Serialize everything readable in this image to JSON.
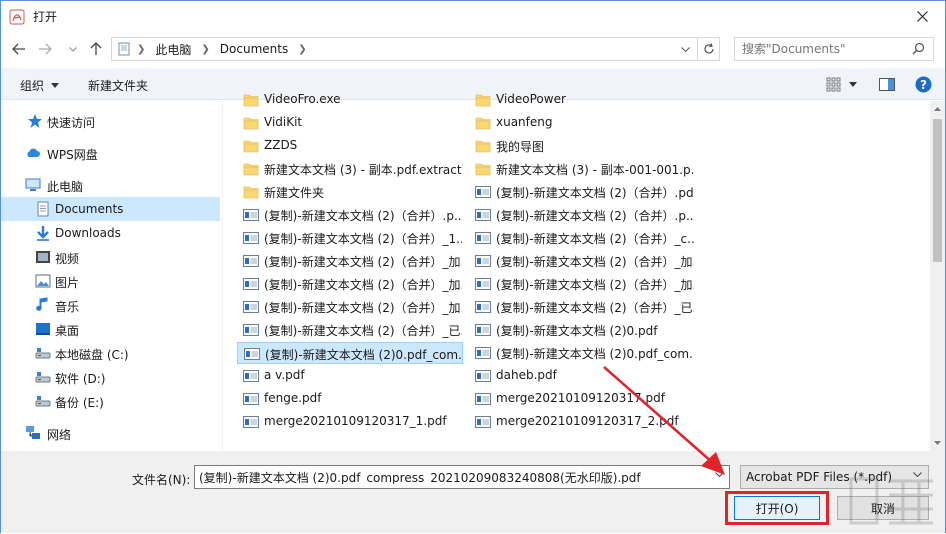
{
  "window": {
    "title": "打开"
  },
  "address": {
    "segments": [
      "此电脑",
      "Documents"
    ]
  },
  "search": {
    "placeholder": "搜索\"Documents\""
  },
  "toolbar": {
    "organize": "组织",
    "new_folder": "新建文件夹"
  },
  "nav": {
    "items": [
      {
        "label": "快速访问",
        "icon": "star-icon"
      },
      {
        "label": "WPS网盘",
        "icon": "cloud-icon"
      },
      {
        "label": "此电脑",
        "icon": "computer-icon"
      },
      {
        "label": "Documents",
        "icon": "document-icon",
        "selected": true
      },
      {
        "label": "Downloads",
        "icon": "download-icon"
      },
      {
        "label": "视频",
        "icon": "video-icon"
      },
      {
        "label": "图片",
        "icon": "picture-icon"
      },
      {
        "label": "音乐",
        "icon": "music-icon"
      },
      {
        "label": "桌面",
        "icon": "desktop-icon"
      },
      {
        "label": "本地磁盘 (C:)",
        "icon": "drive-icon"
      },
      {
        "label": "软件 (D:)",
        "icon": "drive-icon"
      },
      {
        "label": "备份 (E:)",
        "icon": "drive-icon"
      },
      {
        "label": "网络",
        "icon": "network-icon"
      }
    ]
  },
  "files": {
    "left": [
      {
        "name": "VideoFro.exe",
        "type": "folder"
      },
      {
        "name": "VidiKit",
        "type": "folder"
      },
      {
        "name": "ZZDS",
        "type": "folder"
      },
      {
        "name": "新建文本文档 (3) - 副本.pdf.extract...",
        "type": "folder"
      },
      {
        "name": "新建文件夹",
        "type": "folder"
      },
      {
        "name": "(复制)-新建文本文档 (2)（合并）.p...",
        "type": "pdf"
      },
      {
        "name": "(复制)-新建文本文档 (2)（合并）_1....",
        "type": "pdf"
      },
      {
        "name": "(复制)-新建文本文档 (2)（合并）_加...",
        "type": "pdf"
      },
      {
        "name": "(复制)-新建文本文档 (2)（合并）_加...",
        "type": "pdf"
      },
      {
        "name": "(复制)-新建文本文档 (2)（合并）_加...",
        "type": "pdf"
      },
      {
        "name": "(复制)-新建文本文档 (2)（合并）_已...",
        "type": "pdf"
      },
      {
        "name": "(复制)-新建文本文档 (2)0.pdf_com...",
        "type": "pdf",
        "selected": true
      },
      {
        "name": "a v.pdf",
        "type": "pdf"
      },
      {
        "name": "fenge.pdf",
        "type": "pdf"
      },
      {
        "name": "merge20210109120317_1.pdf",
        "type": "pdf"
      }
    ],
    "right": [
      {
        "name": "VideoPower",
        "type": "folder"
      },
      {
        "name": "xuanfeng",
        "type": "folder"
      },
      {
        "name": "我的导图",
        "type": "folder"
      },
      {
        "name": "新建文本文档 (3) - 副本-001-001.p...",
        "type": "folder"
      },
      {
        "name": "(复制)-新建文本文档 (2)（合并）.pdf",
        "type": "pdf"
      },
      {
        "name": "(复制)-新建文本文档 (2)（合并）.p...",
        "type": "pdf"
      },
      {
        "name": "(复制)-新建文本文档 (2)（合并）_c...",
        "type": "pdf"
      },
      {
        "name": "(复制)-新建文本文档 (2)（合并）_加...",
        "type": "pdf"
      },
      {
        "name": "(复制)-新建文本文档 (2)（合并）_加...",
        "type": "pdf"
      },
      {
        "name": "(复制)-新建文本文档 (2)（合并）_已...",
        "type": "pdf"
      },
      {
        "name": "(复制)-新建文本文档 (2)0.pdf",
        "type": "pdf"
      },
      {
        "name": "(复制)-新建文本文档 (2)0.pdf_com...",
        "type": "pdf"
      },
      {
        "name": "daheb.pdf",
        "type": "pdf"
      },
      {
        "name": "merge20210109120317.pdf",
        "type": "pdf"
      },
      {
        "name": "merge20210109120317_2.pdf",
        "type": "pdf"
      }
    ]
  },
  "bottom": {
    "filename_label": "文件名(N):",
    "filename_value": "(复制)-新建文本文档 (2)0.pdf_compress_20210209083240808(无水印版).pdf",
    "filter": "Acrobat PDF Files (*.pdf)",
    "open_label": "打开(O)",
    "cancel_label": "取消"
  },
  "colors": {
    "accent": "#0078d7",
    "selected_bg": "#cce8ff",
    "highlight_red": "#e0242b"
  }
}
